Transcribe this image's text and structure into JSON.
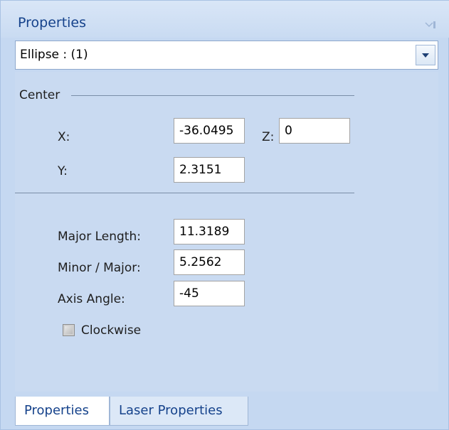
{
  "panel": {
    "title": "Properties"
  },
  "selector": {
    "value": "Ellipse : (1)"
  },
  "center_group": {
    "label": "Center"
  },
  "fields": {
    "x_label": "X:",
    "x_value": "-36.0495",
    "z_label": "Z:",
    "z_value": "0",
    "y_label": "Y:",
    "y_value": "2.3151",
    "major_label": "Major Length:",
    "major_value": "11.3189",
    "minor_label": "Minor / Major:",
    "minor_value": "5.2562",
    "angle_label": "Axis Angle:",
    "angle_value": "-45"
  },
  "clockwise": {
    "label": "Clockwise",
    "checked": false,
    "disabled": true
  },
  "tabs": [
    {
      "label": "Properties",
      "active": true
    },
    {
      "label": "Laser Properties",
      "active": false
    }
  ],
  "colors": {
    "accent": "#15428b",
    "panel_bg": "#c9daf1"
  }
}
